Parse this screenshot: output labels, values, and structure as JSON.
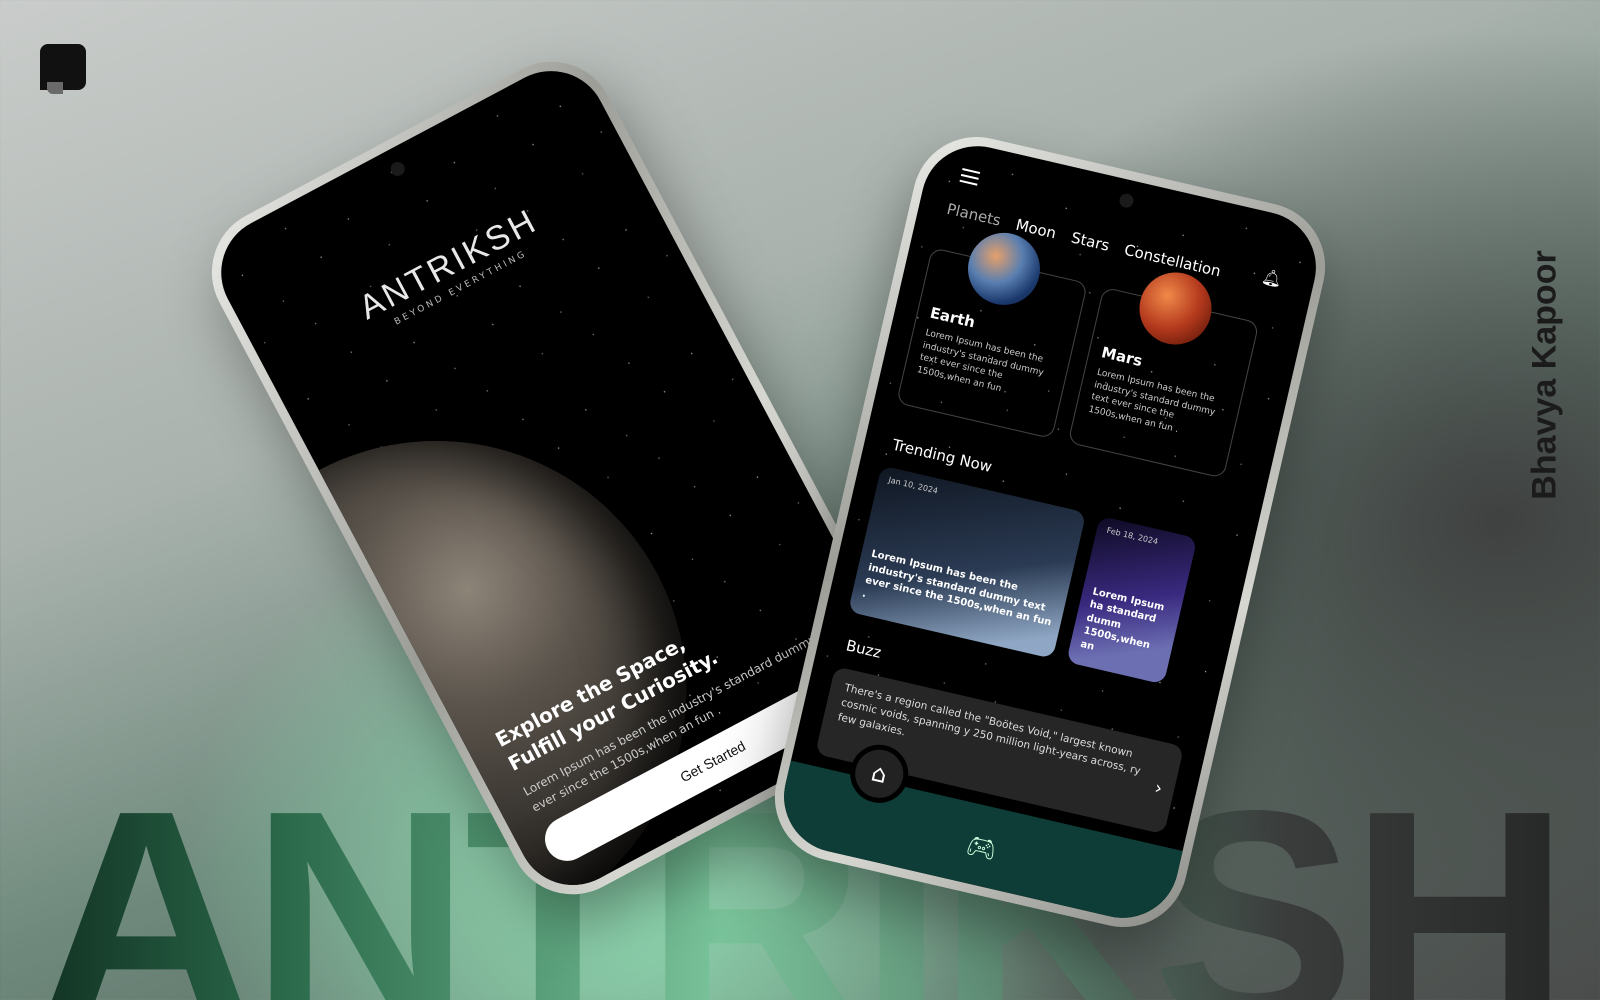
{
  "background_word": "ANTRIKSH",
  "author": "Bhavya Kapoor",
  "icons": {
    "logo": "logo-icon",
    "menu": "hamburger-menu-icon",
    "bell": "bell-icon",
    "home": "home-icon",
    "game": "gamepad-icon",
    "chevron": "chevron-right-icon"
  },
  "welcome": {
    "brand": "ANTRIKSH",
    "tagline": "BEYOND EVERYTHING",
    "headline_1": "Explore the Space,",
    "headline_2": "Fulfill your Curiosity.",
    "body": "Lorem Ipsum has been the industry's standard dummy text ever since the 1500s,when an fun .",
    "cta": "Get Started"
  },
  "home": {
    "tabs": [
      "Planets",
      "Moon",
      "Stars",
      "Constellation"
    ],
    "cards": [
      {
        "title": "Earth",
        "desc": "Lorem Ipsum has been the industry's standard dummy text ever since the 1500s,when an fun ."
      },
      {
        "title": "Mars",
        "desc": "Lorem Ipsum has been the industry's standard dummy text ever since the 1500s,when an fun ."
      }
    ],
    "trending_title": "Trending Now",
    "trending": [
      {
        "date": "Jan 10, 2024",
        "text": "Lorem Ipsum has been the industry's standard dummy text ever since the 1500s,when an fun ."
      },
      {
        "date": "Feb 18, 2024",
        "text": "Lorem Ipsum ha standard dumm 1500s,when an"
      }
    ],
    "buzz_title": "Buzz",
    "buzz_text": "There's a region called the \"Boötes Void,\" largest known cosmic voids, spanning y 250 million light-years across, ry few galaxies."
  },
  "colors": {
    "accent": "#0d3d36",
    "glow": "#8fd7b0"
  }
}
